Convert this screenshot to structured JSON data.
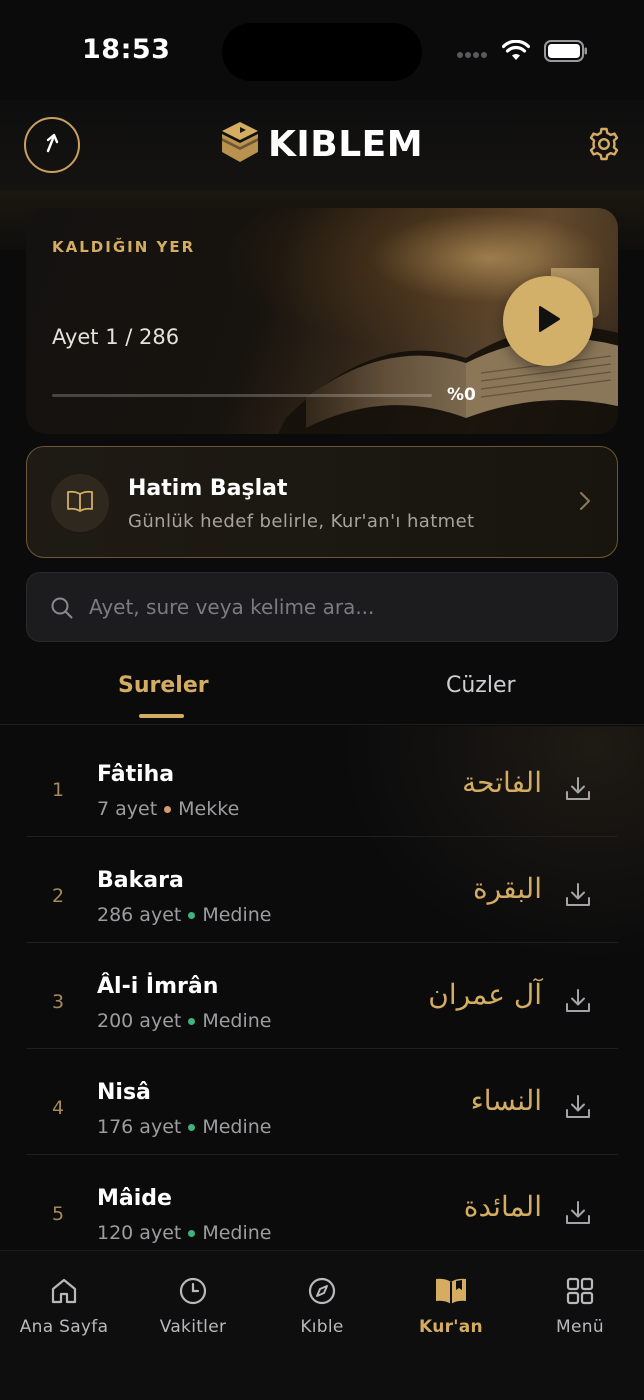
{
  "status": {
    "time": "18:53"
  },
  "header": {
    "logo_text": "KIBLEM"
  },
  "continue_card": {
    "label": "KALDIĞIN YER",
    "ayet_text": "Ayet 1 / 286",
    "progress_text": "%0",
    "progress": 0
  },
  "hatim": {
    "title": "Hatim Başlat",
    "subtitle": "Günlük hedef belirle, Kur'an'ı hatmet"
  },
  "search": {
    "placeholder": "Ayet, sure veya kelime ara..."
  },
  "tabs": {
    "surahs": "Sureler",
    "juz": "Cüzler"
  },
  "surahs": [
    {
      "num": "1",
      "name": "Fâtiha",
      "meta": "7 ayet",
      "place": "Mekke",
      "arabic": "الفاتحة"
    },
    {
      "num": "2",
      "name": "Bakara",
      "meta": "286 ayet",
      "place": "Medine",
      "arabic": "البقرة"
    },
    {
      "num": "3",
      "name": "Âl-i İmrân",
      "meta": "200 ayet",
      "place": "Medine",
      "arabic": "آل عمران"
    },
    {
      "num": "4",
      "name": "Nisâ",
      "meta": "176 ayet",
      "place": "Medine",
      "arabic": "النساء"
    },
    {
      "num": "5",
      "name": "Mâide",
      "meta": "120 ayet",
      "place": "Medine",
      "arabic": "المائدة"
    }
  ],
  "tabbar": {
    "home": "Ana Sayfa",
    "times": "Vakitler",
    "qibla": "Kıble",
    "quran": "Kur'an",
    "menu": "Menü"
  },
  "colors": {
    "accent": "#d4ad63",
    "mekke_dot": "#d79a68",
    "medine_dot": "#3fb27f"
  }
}
